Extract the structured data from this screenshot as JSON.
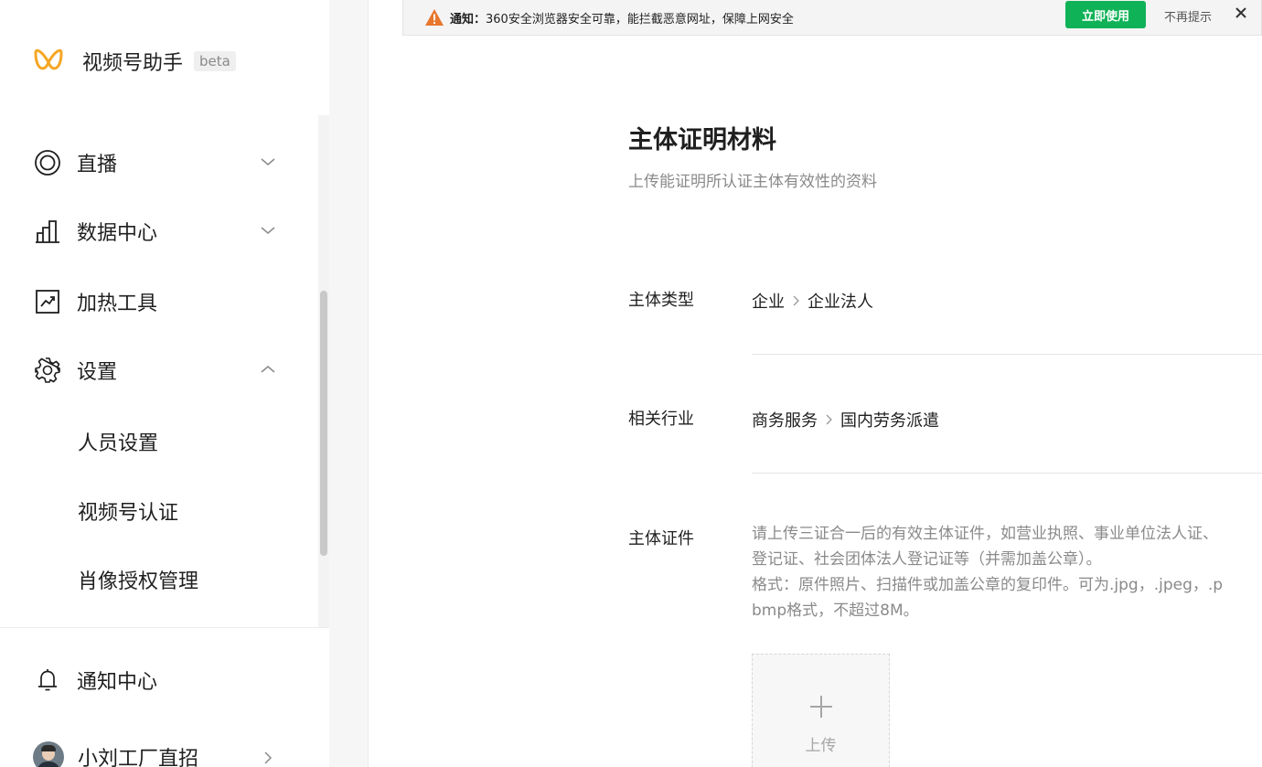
{
  "sidebar": {
    "brand_title": "视频号助手",
    "brand_badge": "beta",
    "brand_color": "#f5a623",
    "nav": {
      "live": {
        "label": "直播",
        "icon": "live-ring-icon"
      },
      "data_center": {
        "label": "数据中心",
        "icon": "bar-chart-icon"
      },
      "boost_tools": {
        "label": "加热工具",
        "icon": "trend-chart-icon"
      },
      "settings": {
        "label": "设置",
        "icon": "gear-icon",
        "expanded": true
      },
      "settings_sub": [
        "人员设置",
        "视频号认证",
        "肖像授权管理"
      ],
      "notifications": {
        "label": "通知中心",
        "icon": "bell-icon"
      }
    },
    "account_name": "小刘工厂直招"
  },
  "notification_bar": {
    "title": "通知：",
    "message": "360安全浏览器安全可靠，能拦截恶意网址，保障上网安全",
    "action_label": "立即使用",
    "dismiss_label": "不再提示",
    "action_color": "#10b257",
    "warning_color": "#e8762c"
  },
  "main": {
    "section_title": "主体证明材料",
    "section_desc": "上传能证明所认证主体有效性的资料",
    "subject_type": {
      "label": "主体类型",
      "level1": "企业",
      "level2": "企业法人"
    },
    "industry": {
      "label": "相关行业",
      "level1": "商务服务",
      "level2": "国内劳务派遣"
    },
    "certificate": {
      "label": "主体证件",
      "hint_lines": [
        "请上传三证合一后的有效主体证件，如营业执照、事业单位法人证、",
        "登记证、社会团体法人登记证等（并需加盖公章）。",
        "格式：原件照片、扫描件或加盖公章的复印件。可为.jpg，.jpeg，.p",
        "bmp格式，不超过8M。"
      ],
      "upload_label": "上传"
    }
  }
}
